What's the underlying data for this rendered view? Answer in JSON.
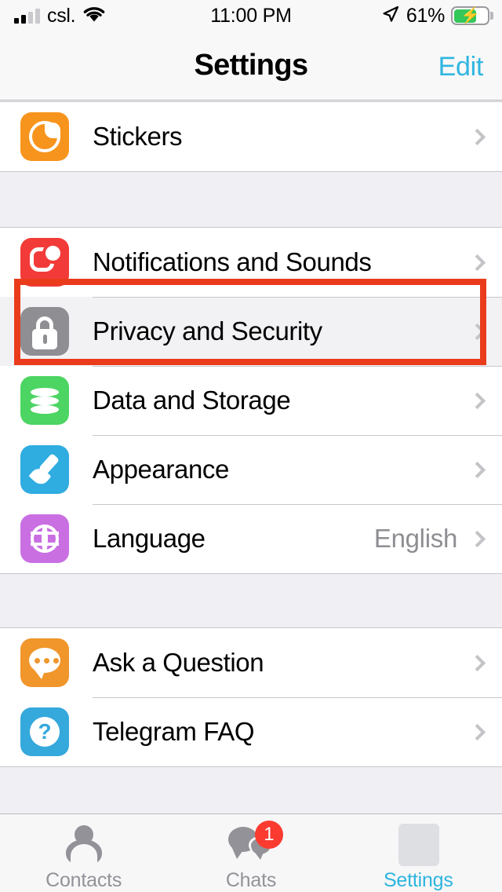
{
  "status_bar": {
    "carrier": "csl.",
    "time": "11:00 PM",
    "battery_percent": "61%",
    "signal_icon": "cellular-bars-icon",
    "wifi_icon": "wifi-icon",
    "location_icon": "location-arrow-icon",
    "battery_icon": "battery-charging-icon",
    "signal_bars_filled": 2,
    "signal_bars_total": 4,
    "battery_level": 61,
    "charging": true
  },
  "nav": {
    "title": "Settings",
    "edit_label": "Edit"
  },
  "groups": [
    {
      "rows": [
        {
          "label": "Stickers",
          "icon": "stickers-icon",
          "value": "",
          "selected": false
        }
      ]
    },
    {
      "rows": [
        {
          "label": "Notifications and Sounds",
          "icon": "notifications-icon",
          "value": "",
          "selected": false
        },
        {
          "label": "Privacy and Security",
          "icon": "lock-icon",
          "value": "",
          "selected": true
        },
        {
          "label": "Data and Storage",
          "icon": "database-icon",
          "value": "",
          "selected": false
        },
        {
          "label": "Appearance",
          "icon": "paintbrush-icon",
          "value": "",
          "selected": false
        },
        {
          "label": "Language",
          "icon": "globe-icon",
          "value": "English",
          "selected": false
        }
      ]
    },
    {
      "rows": [
        {
          "label": "Ask a Question",
          "icon": "speech-bubble-icon",
          "value": "",
          "selected": false
        },
        {
          "label": "Telegram FAQ",
          "icon": "question-mark-icon",
          "value": "",
          "selected": false
        }
      ]
    }
  ],
  "tabs": [
    {
      "label": "Contacts",
      "icon": "person-icon",
      "badge": "",
      "active": false
    },
    {
      "label": "Chats",
      "icon": "chats-icon",
      "badge": "1",
      "active": false
    },
    {
      "label": "Settings",
      "icon": "settings-placeholder-icon",
      "badge": "",
      "active": true
    }
  ],
  "annotation": {
    "target": "Privacy and Security",
    "color": "#EA3C1C"
  },
  "colors": {
    "accent": "#2DB5DE",
    "separator": "#C8C7CC",
    "group_background": "#EFEFF4",
    "row_background": "#FFFFFF",
    "badge_red": "#FB3B30",
    "battery_green": "#34C759"
  }
}
